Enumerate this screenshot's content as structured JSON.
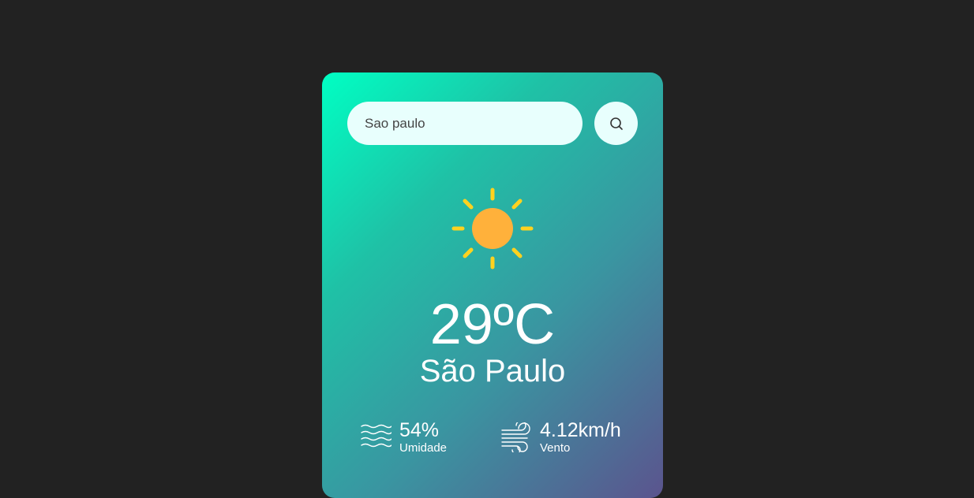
{
  "search": {
    "value": "Sao paulo",
    "button_icon": "search-icon"
  },
  "weather": {
    "icon": "sun-icon",
    "temperature": "29ºC",
    "city": "São Paulo"
  },
  "details": {
    "humidity": {
      "icon": "waves-icon",
      "value": "54%",
      "label": "Umidade"
    },
    "wind": {
      "icon": "wind-icon",
      "value": "4.12km/h",
      "label": "Vento"
    }
  },
  "colors": {
    "page_background": "#222222",
    "gradient_start": "#00ffc3",
    "gradient_end": "#5b548e",
    "sun_core": "#ffb13b",
    "sun_rays": "#ffd21f",
    "input_background": "#e8fffd"
  }
}
